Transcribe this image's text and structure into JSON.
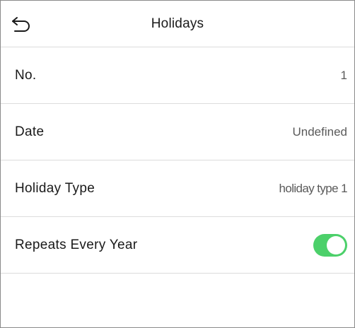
{
  "header": {
    "title": "Holidays",
    "back_icon": "back-arrow-icon"
  },
  "rows": [
    {
      "label": "No.",
      "value": "1"
    },
    {
      "label": "Date",
      "value": "Undefined"
    },
    {
      "label": "Holiday Type",
      "value": "holiday type 1"
    },
    {
      "label": "Repeats Every Year",
      "toggle_on": true
    }
  ],
  "colors": {
    "toggle_on": "#4cd06a",
    "divider": "#dcdcdc",
    "frame": "#8a8a8a"
  }
}
